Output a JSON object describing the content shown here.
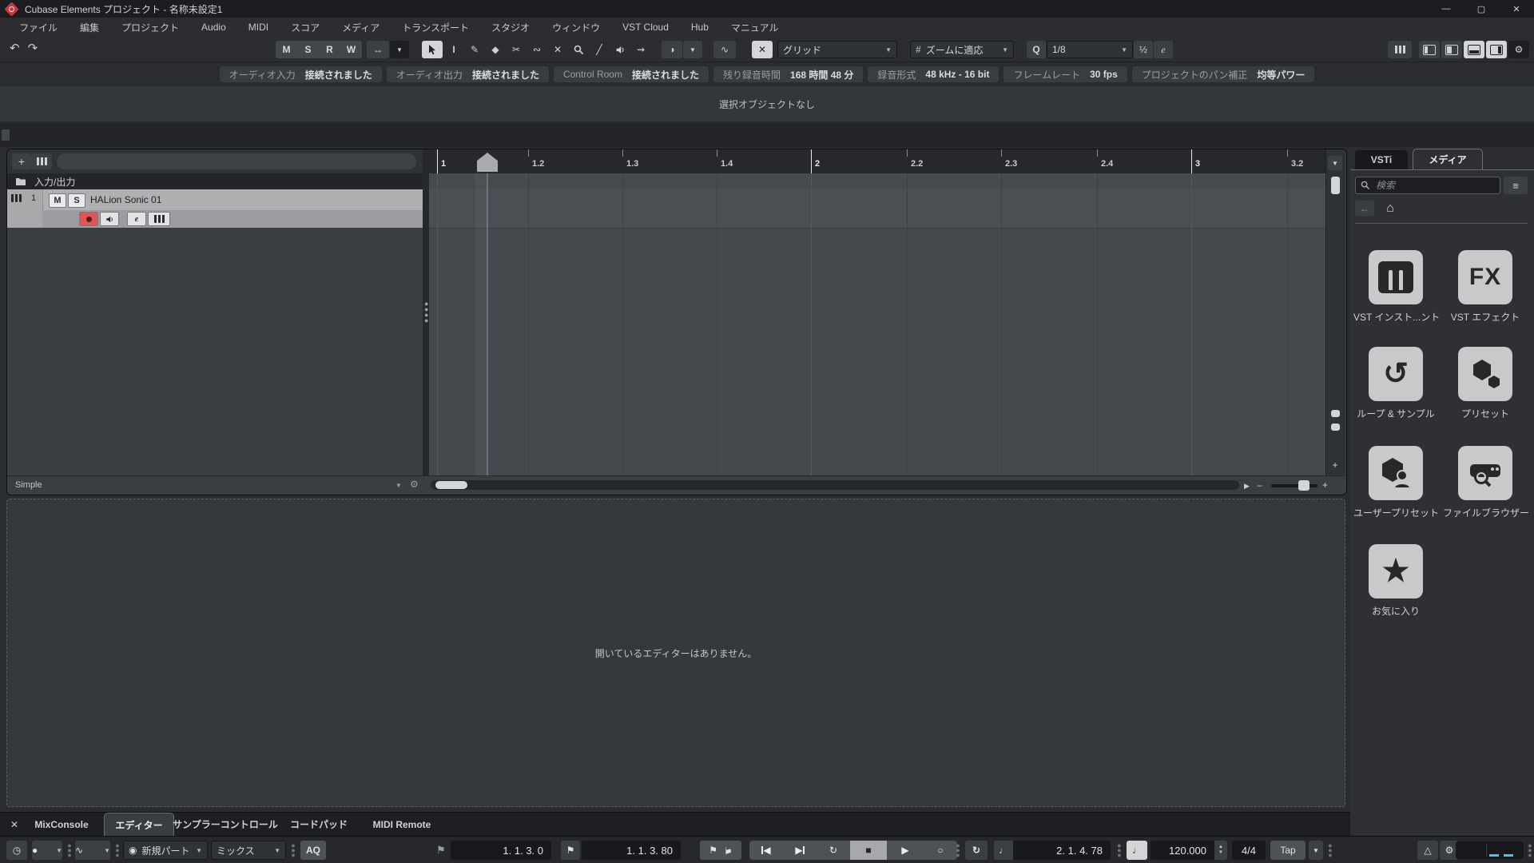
{
  "window": {
    "title": "Cubase Elements プロジェクト - 名称未設定1"
  },
  "menu": {
    "items": [
      "ファイル",
      "編集",
      "プロジェクト",
      "Audio",
      "MIDI",
      "スコア",
      "メディア",
      "トランスポート",
      "スタジオ",
      "ウィンドウ",
      "VST Cloud",
      "Hub",
      "マニュアル"
    ]
  },
  "toolbar": {
    "msrw": [
      "M",
      "S",
      "R",
      "W"
    ],
    "grid_label": "グリッド",
    "zoom_fit_label": "ズームに適応",
    "quantize_value": "1/8"
  },
  "info_line": {
    "tokens": [
      {
        "label": "オーディオ入力",
        "value": "接続されました"
      },
      {
        "label": "オーディオ出力",
        "value": "接続されました"
      },
      {
        "label": "Control Room",
        "value": "接続されました"
      },
      {
        "label": "残り録音時間",
        "value": "168 時間 48 分"
      },
      {
        "label": "録音形式",
        "value": "48 kHz - 16 bit"
      },
      {
        "label": "フレームレート",
        "value": "30 fps"
      },
      {
        "label": "プロジェクトのパン補正",
        "value": "均等パワー"
      }
    ]
  },
  "status_line": {
    "text": "選択オブジェクトなし"
  },
  "project": {
    "io_label": "入力/出力",
    "track_number": "1",
    "track_name": "HALion Sonic 01",
    "mute": "M",
    "solo": "S",
    "edit": "e",
    "view_label": "Simple",
    "ruler_labels": [
      "1",
      "1.2",
      "1.3",
      "1.4",
      "2",
      "2.2",
      "2.3",
      "2.4",
      "3",
      "3.2"
    ]
  },
  "lower_zone": {
    "empty_text": "開いているエディターはありません。"
  },
  "right_panel": {
    "tab_vsti": "VSTi",
    "tab_media": "メディア",
    "search_placeholder": "検索",
    "tiles": [
      {
        "label": "VST インスト...ント"
      },
      {
        "label": "VST エフェクト"
      },
      {
        "label": "ループ & サンプル"
      },
      {
        "label": "プリセット"
      },
      {
        "label": "ユーザープリセット"
      },
      {
        "label": "ファイルブラウザー"
      },
      {
        "label": "お気に入り"
      }
    ]
  },
  "bottom_tabs": {
    "items": [
      "MixConsole",
      "エディター",
      "サンプラーコントロール",
      "コードパッド",
      "MIDI Remote"
    ]
  },
  "transport": {
    "new_part": "新規パート",
    "midi_mix": "ミックス",
    "aq": "AQ",
    "left_locator": "1. 1. 3. 0",
    "right_locator": "1. 1. 3. 80",
    "time": "2. 1. 4. 78",
    "tempo": "120.000",
    "signature": "4/4",
    "tap": "Tap"
  },
  "colors": {
    "accent_record": "#e05555",
    "meter_cyan": "#4ac4d6"
  },
  "icons": {
    "minimize": "—",
    "maximize": "▢",
    "close": "✕",
    "undo": "↶",
    "redo": "↷",
    "autoscroll": "↔",
    "dropdown": "▼",
    "range_tool": "I",
    "draw_tool": "✎",
    "erase_tool": "◆",
    "split_tool": "✂",
    "glue_tool": "∾",
    "mute_tool": "✕",
    "line_tool": "╱",
    "scrub_tool": "⇝",
    "color_tool": "◑",
    "automation_tool": "∿",
    "snap": "✕",
    "grid_hash": "#",
    "quantize_q": "Q",
    "triplet": "½",
    "quantize_open": "e",
    "add": "+",
    "back": "←",
    "home": "⌂",
    "list": "≡",
    "loop": "↺",
    "star": "★",
    "fx_badge": "FX",
    "flag": "⚑",
    "prev": "◀",
    "next": "▶",
    "cycle": "↻",
    "stop": "■",
    "play": "▶",
    "record": "○",
    "midi_dot": "◉",
    "wave": "∿",
    "note": "♩",
    "spin_up": "▲",
    "spin_down": "▼",
    "metronome": "△",
    "gear": "⚙",
    "clock": "◷",
    "scroll_up": "▲",
    "scroll_down": "▼",
    "scroll_left": "◀",
    "scroll_right": "▶",
    "plus": "+",
    "minus": "−",
    "rec_dot": "●"
  }
}
